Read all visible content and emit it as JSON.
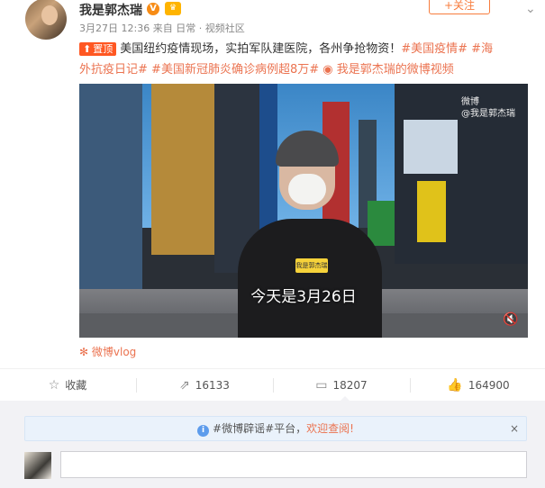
{
  "post": {
    "username": "我是郭杰瑞",
    "v_badge": "V",
    "member_badge": "👑",
    "follow_label": "+关注",
    "more_icon": "chevron-down-icon",
    "time": "3月27日 12:36",
    "source": "来自 日常 · 视频社区",
    "pin_label": "置顶",
    "text": "美国纽约疫情现场，实拍军队建医院，各州争抢物资！",
    "tags": [
      "#美国疫情#",
      "#海外抗疫日记#",
      "#美国新冠肺炎确诊病例超8万#"
    ],
    "video_link": "我是郭杰瑞的微博视频",
    "video_subtitle": "今天是3月26日",
    "mic_label": "我是郭杰瑞",
    "watermark_line1": "微博",
    "watermark_line2": "@我是郭杰瑞",
    "vlog_label": "微博vlog"
  },
  "actions": {
    "favorite_label": "收藏",
    "repost_count": "16133",
    "comment_count": "18207",
    "like_count": "164900"
  },
  "comments": {
    "notice_prefix": "#微博辟谣#平台，",
    "notice_link": "欢迎查阅!",
    "close_label": "×"
  },
  "colors": {
    "accent": "#eb7350",
    "follow": "#f77c3d",
    "pin": "#ff5722",
    "notice_bg": "#eaf2fb"
  }
}
